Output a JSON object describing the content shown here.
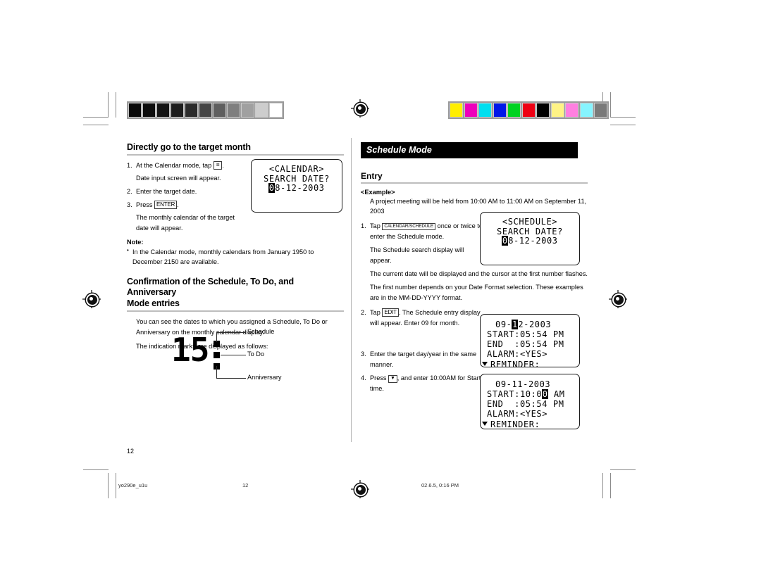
{
  "document": {
    "page_number": "12",
    "footer": {
      "filename": "yo290e_u1u",
      "page": "12",
      "timestamp": "02.6.5, 0:16 PM"
    }
  },
  "color_bars": {
    "grayscale": {
      "label": "grayscale-step-wedge",
      "swatches": [
        "#0a0a0a",
        "#0d0d0d",
        "#141414",
        "#1d1d1d",
        "#2b2b2b",
        "#454545",
        "#5f5f5f",
        "#7f7f7f",
        "#a0a0a0",
        "#cdcdcd",
        "#ffffff"
      ]
    },
    "process": {
      "label": "process-color-bar",
      "swatches": [
        "#ffee00",
        "#ee00bb",
        "#00dff0",
        "#0018e8",
        "#00d221",
        "#ee0013",
        "#000000",
        "#fff385",
        "#ff7fe0",
        "#86f4ff",
        "#7a7a7a"
      ]
    }
  },
  "left_column": {
    "section1": {
      "title": "Directly go to the target month",
      "steps": [
        {
          "num": "1.",
          "text_before": "At the Calendar mode, tap ",
          "key": "=",
          "text_after": ".",
          "sub": "Date input screen will appear."
        },
        {
          "num": "2.",
          "text_before": "Enter the target date.",
          "key": "",
          "text_after": "",
          "sub": ""
        },
        {
          "num": "3.",
          "text_before": "Press ",
          "key": "ENTER",
          "text_after": ".",
          "sub": "The monthly calendar of the target date will appear."
        }
      ],
      "note_heading": "Note:",
      "note_items": [
        "In the Calendar mode, monthly calendars from January 1950 to December 2150 are available."
      ]
    },
    "section2": {
      "title_line1": "Confirmation of the Schedule, To Do, and Anniversary",
      "title_line2": "Mode entries",
      "paragraphs": [
        "You can see the dates to which you assigned a Schedule, To Do or Anniversary on the monthly calendar display.",
        "The indication marks are displayed as follows:"
      ],
      "mark_diagram": {
        "digits": "15",
        "labels": [
          "Schedule",
          "To Do",
          "Anniversary"
        ]
      }
    }
  },
  "right_column": {
    "mode_banner": "Schedule Mode",
    "section_title": "Entry",
    "example_heading": "<Example>",
    "example_text_line1": "A project meeting will be held from 10:00 AM to 11:00 AM on",
    "example_text_line2": "September 11, 2003",
    "steps": [
      {
        "num": "1.",
        "text_before": "Tap ",
        "key": "CALENDAR/SCHEDULE",
        "text_after": " once or twice to enter the Schedule mode.",
        "subs": [
          "The Schedule search display will appear.",
          "The current date will be displayed and the cursor at the first number flashes.",
          "The first number depends on your Date Format selection. These examples are in the MM-DD-YYYY format."
        ]
      },
      {
        "num": "2.",
        "text_before": "Tap ",
        "key": "EDIT",
        "text_after": ". The Schedule entry display will appear. Enter 09 for month.",
        "subs": []
      },
      {
        "num": "3.",
        "text_before": "Enter the target day/year in the same manner.",
        "key": "",
        "text_after": "",
        "subs": []
      },
      {
        "num": "4.",
        "text_before": "Press ",
        "key": "▼",
        "text_after": ", and enter 10:00AM for Start time.",
        "subs": []
      }
    ]
  },
  "lcd_screens": {
    "calendar_search": {
      "name": "lcd-calendar-search",
      "line1": "<CALENDAR>",
      "line2": "SEARCH DATE?",
      "line3_cursor": "0",
      "line3_rest": "8-12-2003"
    },
    "schedule_search": {
      "name": "lcd-schedule-search",
      "line1": "<SCHEDULE>",
      "line2": "SEARCH DATE?",
      "line3_cursor": "0",
      "line3_rest": "8-12-2003"
    },
    "schedule_entry_1": {
      "name": "lcd-schedule-entry-month",
      "date_pre": "09-",
      "date_cursor": "1",
      "date_post": "2-2003",
      "start_label": "START:",
      "start_value": "05:54",
      "start_ampm": "PM",
      "end_label": "END  :",
      "end_value": "05:54",
      "end_ampm": "PM",
      "alarm_label": "ALARM:",
      "alarm_value": "<YES>",
      "reminder_label": "REMINDER:"
    },
    "schedule_entry_2": {
      "name": "lcd-schedule-entry-time",
      "date_full": "09-11-2003",
      "start_label": "START:",
      "start_pre": "10:0",
      "start_cursor": "0",
      "start_ampm": "AM",
      "end_label": "END  :",
      "end_value": "05:54",
      "end_ampm": "PM",
      "alarm_label": "ALARM:",
      "alarm_value": "<YES>",
      "reminder_label": "REMINDER:"
    }
  }
}
